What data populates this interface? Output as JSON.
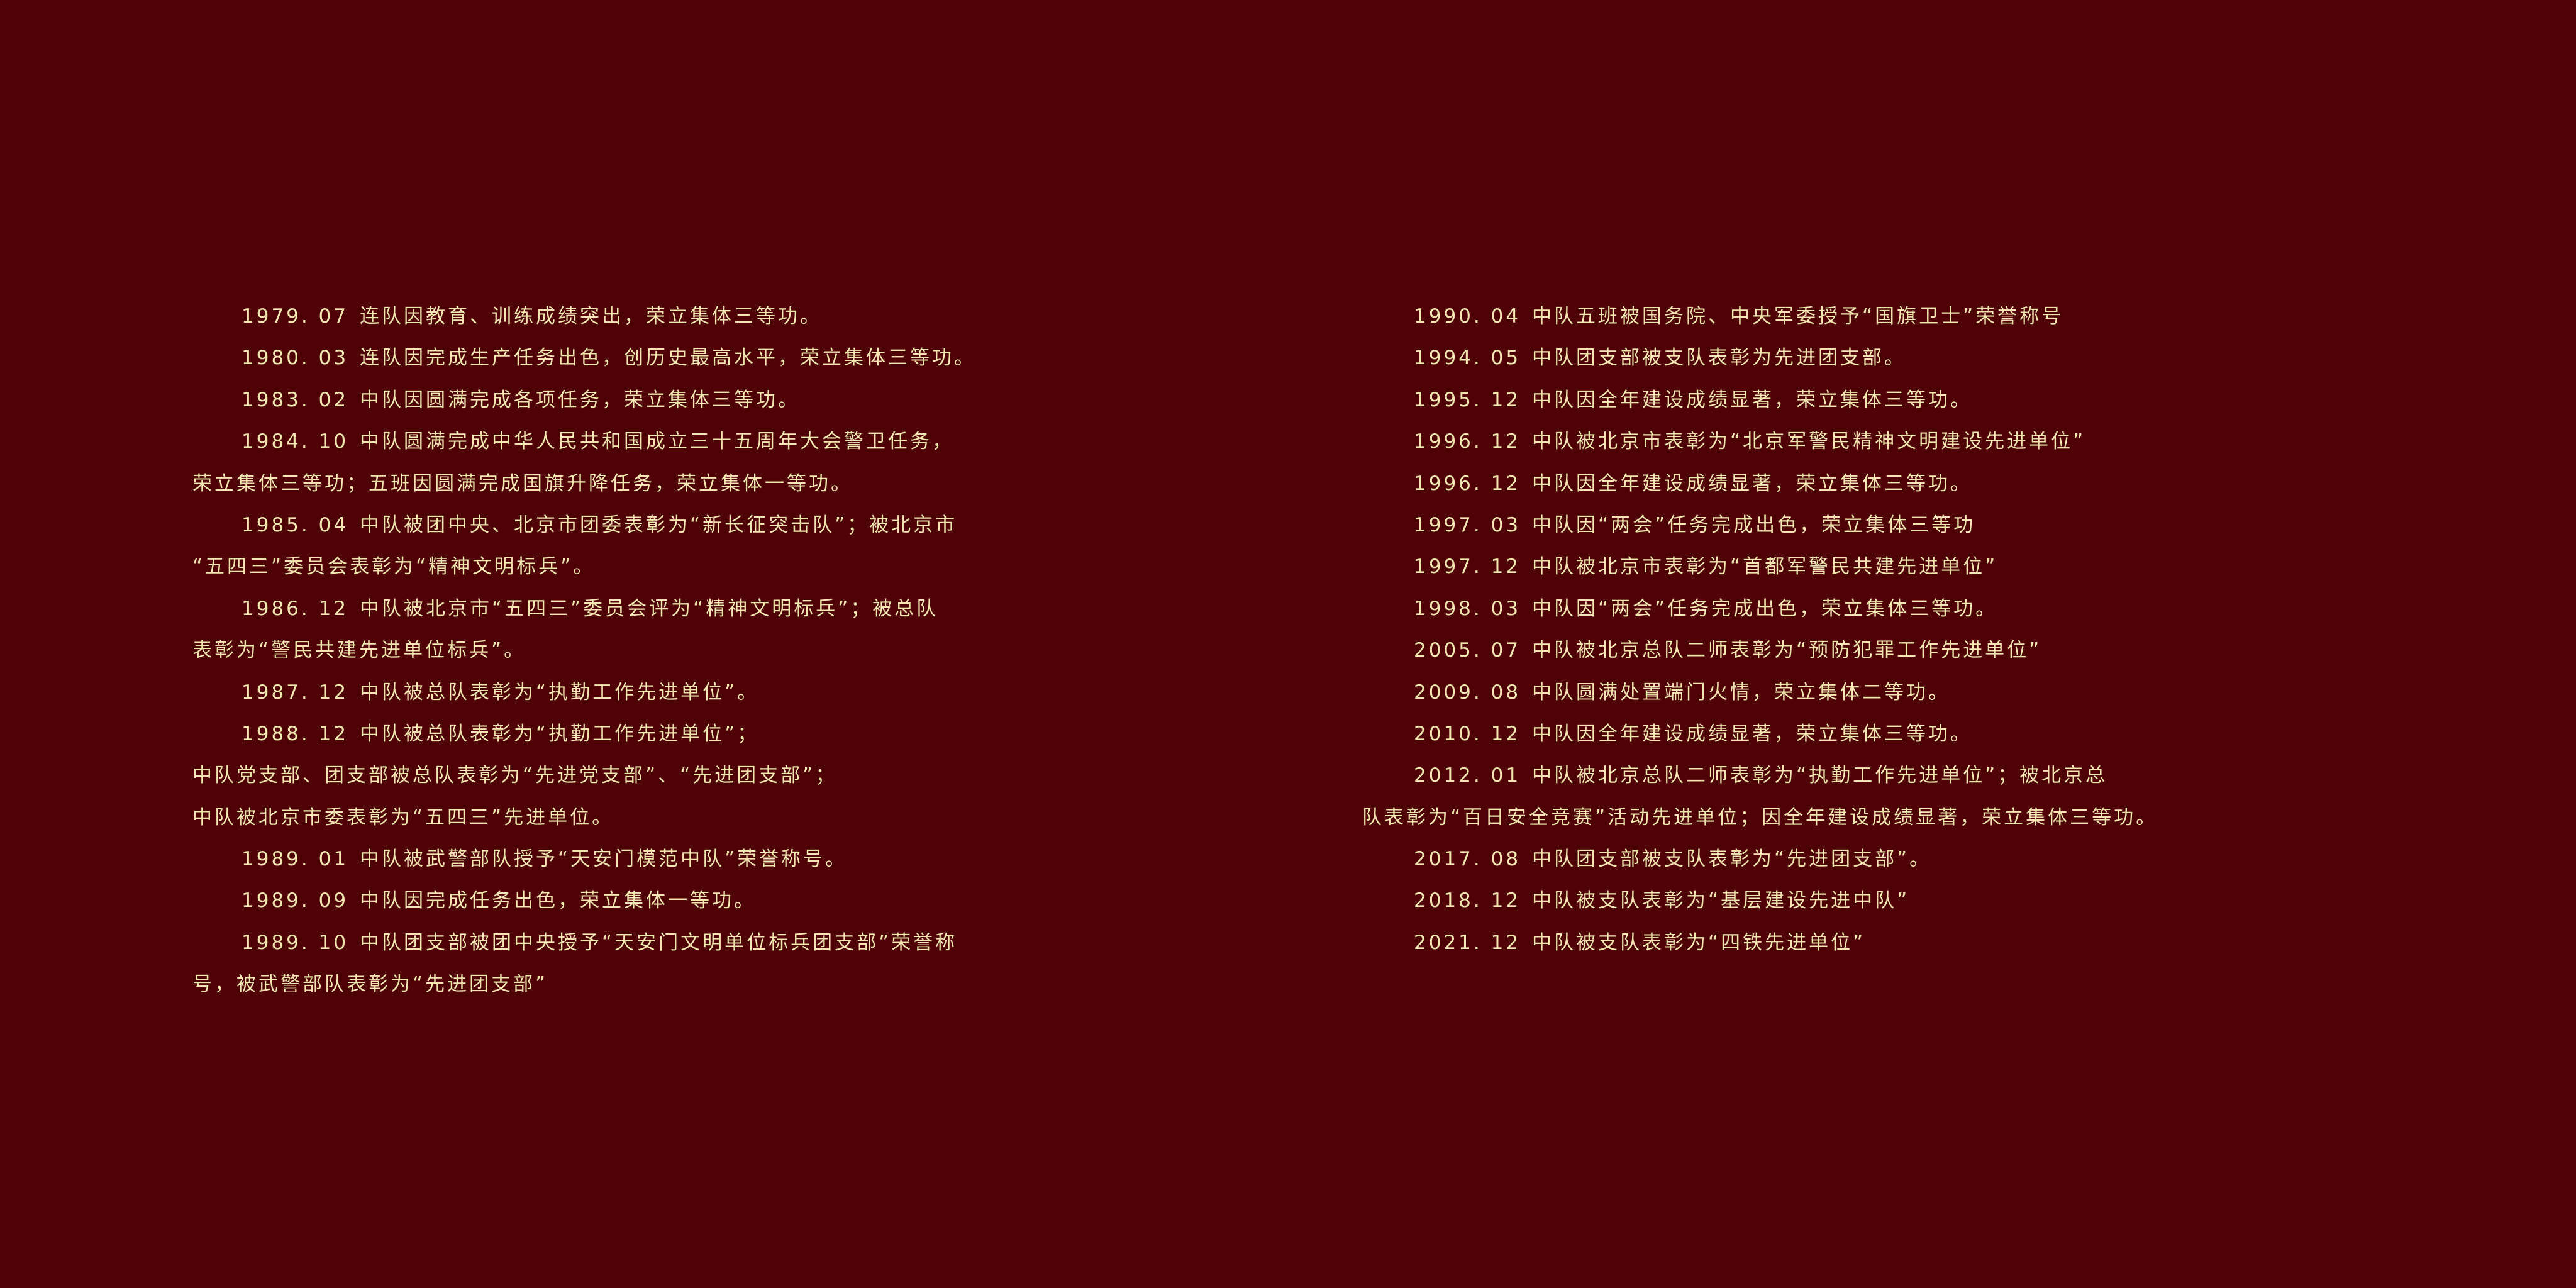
{
  "left_column": {
    "lines": [
      {
        "date": "1979. 07",
        "text": "连队因教育、训练成绩突出，荣立集体三等功。"
      },
      {
        "date": "1980. 03",
        "text": "连队因完成生产任务出色，创历史最高水平，荣立集体三等功。"
      },
      {
        "date": "1983. 02",
        "text": "中队因圆满完成各项任务，荣立集体三等功。"
      },
      {
        "date": "1984. 10",
        "text": "中队圆满完成中华人民共和国成立三十五周年大会警卫任务，"
      },
      {
        "text": "荣立集体三等功；五班因圆满完成国旗升降任务，荣立集体一等功。"
      },
      {
        "date": "1985. 04",
        "text": "中队被团中央、北京市团委表彰为“新长征突击队”；被北京市"
      },
      {
        "text": "“五四三”委员会表彰为“精神文明标兵”。"
      },
      {
        "date": "1986. 12",
        "text": "中队被北京市“五四三”委员会评为“精神文明标兵”；被总队"
      },
      {
        "text": "表彰为“警民共建先进单位标兵”。"
      },
      {
        "date": "1987. 12",
        "text": "中队被总队表彰为“执勤工作先进单位”。"
      },
      {
        "date": "1988. 12",
        "text": "中队被总队表彰为“执勤工作先进单位”；"
      },
      {
        "text": "中队党支部、团支部被总队表彰为“先进党支部”、“先进团支部”；"
      },
      {
        "text": "中队被北京市委表彰为“五四三”先进单位。"
      },
      {
        "date": "1989. 01",
        "text": "中队被武警部队授予“天安门模范中队”荣誉称号。"
      },
      {
        "date": "1989. 09",
        "text": "中队因完成任务出色，荣立集体一等功。"
      },
      {
        "date": "1989. 10",
        "text": "中队团支部被团中央授予“天安门文明单位标兵团支部”荣誉称"
      },
      {
        "text": "号，被武警部队表彰为“先进团支部”"
      }
    ]
  },
  "right_column": {
    "lines": [
      {
        "date": "1990. 04",
        "text": "中队五班被国务院、中央军委授予“国旗卫士”荣誉称号"
      },
      {
        "date": "1994. 05",
        "text": "中队团支部被支队表彰为先进团支部。"
      },
      {
        "date": "1995. 12",
        "text": "中队因全年建设成绩显著，荣立集体三等功。"
      },
      {
        "date": "1996. 12",
        "text": "中队被北京市表彰为“北京军警民精神文明建设先进单位”"
      },
      {
        "date": "1996. 12",
        "text": "中队因全年建设成绩显著，荣立集体三等功。"
      },
      {
        "date": "1997. 03",
        "text": "中队因“两会”任务完成出色，荣立集体三等功"
      },
      {
        "date": "1997. 12",
        "text": "中队被北京市表彰为“首都军警民共建先进单位”"
      },
      {
        "date": "1998. 03",
        "text": "中队因“两会”任务完成出色，荣立集体三等功。"
      },
      {
        "date": "2005. 07",
        "text": "中队被北京总队二师表彰为“预防犯罪工作先进单位”"
      },
      {
        "date": "2009. 08",
        "text": "中队圆满处置端门火情，荣立集体二等功。"
      },
      {
        "date": "2010. 12",
        "text": "中队因全年建设成绩显著，荣立集体三等功。"
      },
      {
        "date": "2012. 01",
        "text": "中队被北京总队二师表彰为“执勤工作先进单位”；被北京总"
      },
      {
        "text": "队表彰为“百日安全竞赛”活动先进单位；因全年建设成绩显著，荣立集体三等功。"
      },
      {
        "date": "2017. 08",
        "text": "中队团支部被支队表彰为“先进团支部”。"
      },
      {
        "date": "2018. 12",
        "text": "中队被支队表彰为“基层建设先进中队”"
      },
      {
        "date": "2021. 12",
        "text": "中队被支队表彰为“四铁先进单位”"
      }
    ]
  }
}
